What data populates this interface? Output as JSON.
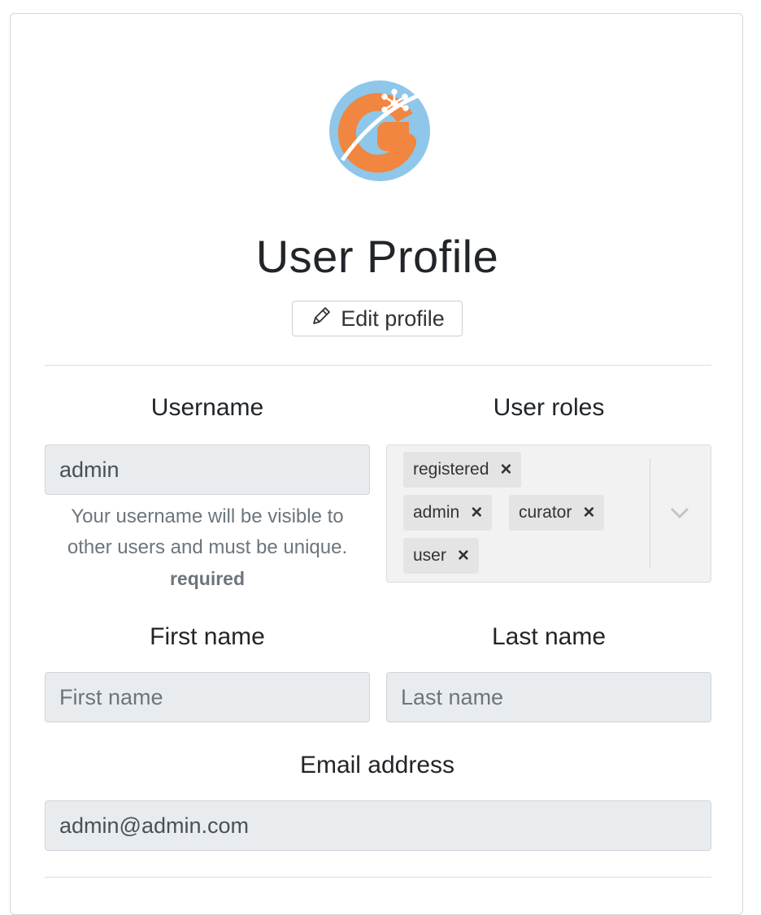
{
  "header": {
    "logo_icon": "galaxy-g-logo",
    "title": "User Profile",
    "edit_button_label": "Edit profile",
    "edit_icon": "pencil-icon"
  },
  "username": {
    "label": "Username",
    "value": "admin",
    "help_line1": "Your username will be visible to",
    "help_line2": "other users and must be unique.",
    "required": "required"
  },
  "roles": {
    "label": "User roles",
    "items": [
      "registered",
      "admin",
      "curator",
      "user"
    ],
    "remove_glyph": "×",
    "dropdown_icon": "chevron-down-icon"
  },
  "first_name": {
    "label": "First name",
    "value": "",
    "placeholder": "First name"
  },
  "last_name": {
    "label": "Last name",
    "value": "",
    "placeholder": "Last name"
  },
  "email": {
    "label": "Email address",
    "value": "admin@admin.com"
  },
  "colors": {
    "logo_blue": "#8ec7ea",
    "logo_orange": "#f0863f",
    "input_bg": "#e9ecef",
    "tag_bg": "#e4e4e4"
  }
}
